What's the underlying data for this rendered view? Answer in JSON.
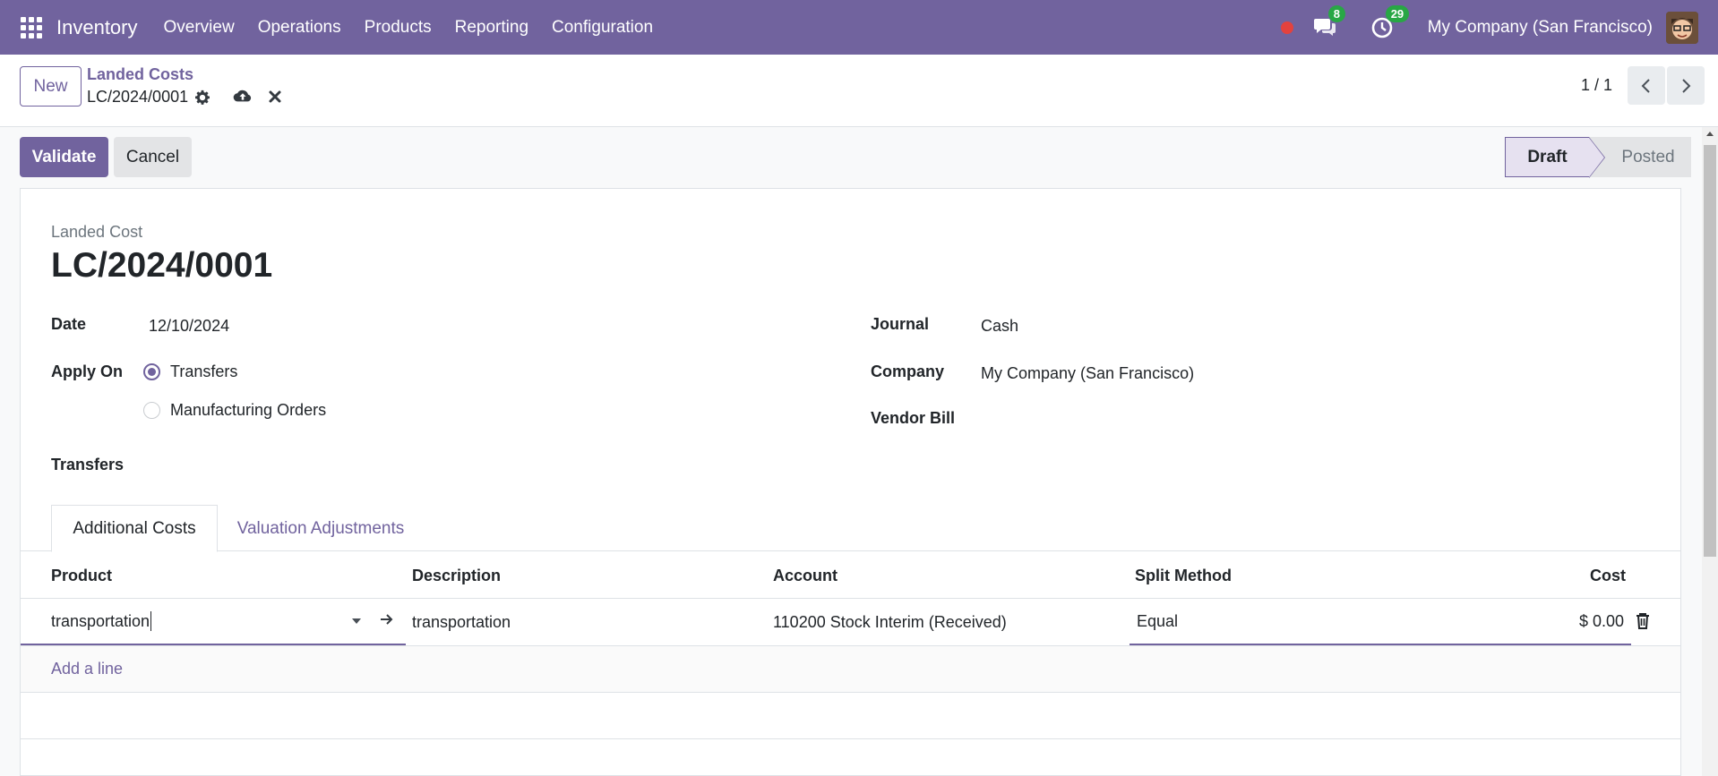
{
  "navbar": {
    "app_name": "Inventory",
    "menu": [
      "Overview",
      "Operations",
      "Products",
      "Reporting",
      "Configuration"
    ],
    "messages_count": "8",
    "activities_count": "29",
    "company": "My Company (San Francisco)"
  },
  "control_panel": {
    "new_label": "New",
    "breadcrumb_parent": "Landed Costs",
    "breadcrumb_current": "LC/2024/0001",
    "pager": "1 / 1"
  },
  "actions": {
    "validate": "Validate",
    "cancel": "Cancel"
  },
  "status": {
    "draft": "Draft",
    "posted": "Posted"
  },
  "form": {
    "label": "Landed Cost",
    "title": "LC/2024/0001",
    "date_label": "Date",
    "date_value": "12/10/2024",
    "apply_on_label": "Apply On",
    "apply_on_options": [
      "Transfers",
      "Manufacturing Orders"
    ],
    "transfers_label": "Transfers",
    "journal_label": "Journal",
    "journal_value": "Cash",
    "company_label": "Company",
    "company_value": "My Company (San Francisco)",
    "vendor_bill_label": "Vendor Bill"
  },
  "tabs": [
    "Additional Costs",
    "Valuation Adjustments"
  ],
  "table": {
    "headers": [
      "Product",
      "Description",
      "Account",
      "Split Method",
      "Cost"
    ],
    "rows": [
      {
        "product": "transportation",
        "description": "transportation",
        "account": "110200 Stock Interim (Received)",
        "split_method": "Equal",
        "cost": "$ 0.00"
      }
    ],
    "add_line": "Add a line"
  },
  "colors": {
    "brand": "#71639e",
    "badge": "#28a745",
    "record": "#e3423e"
  }
}
